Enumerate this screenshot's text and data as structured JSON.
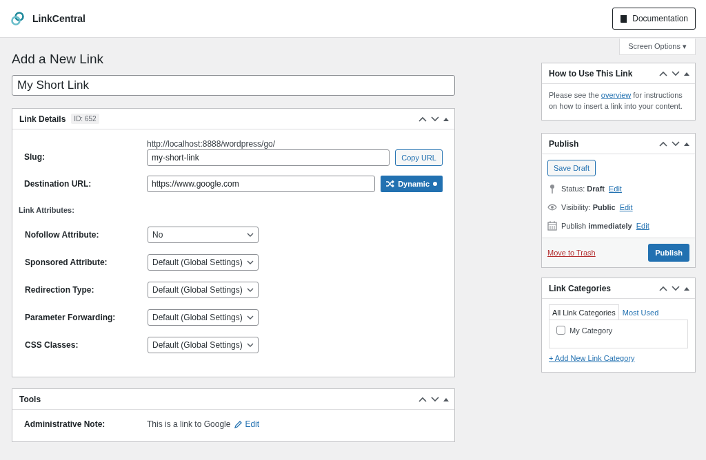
{
  "header": {
    "brand": "LinkCentral",
    "doc_button": "Documentation"
  },
  "screen_options": "Screen Options ▾",
  "page_title": "Add a New Link",
  "title_field": {
    "value": "My Short Link"
  },
  "link_details": {
    "title": "Link Details",
    "id_badge": "ID: 652",
    "fields": [
      {
        "kind": "slug",
        "label": "Slug:",
        "prefix": "http://localhost:8888/wordpress/go/",
        "value": "my-short-link",
        "button": "Copy URL"
      },
      {
        "kind": "url",
        "label": "Destination URL:",
        "value": "https://www.google.com",
        "button": "Dynamic"
      }
    ],
    "attributes_heading": "Link Attributes:",
    "attributes": [
      {
        "label": "Nofollow Attribute:",
        "value": "No"
      },
      {
        "label": "Sponsored Attribute:",
        "value": "Default (Global Settings)"
      },
      {
        "label": "Redirection Type:",
        "value": "Default (Global Settings)"
      },
      {
        "label": "Parameter Forwarding:",
        "value": "Default (Global Settings)"
      },
      {
        "label": "CSS Classes:",
        "value": "Default (Global Settings)"
      }
    ]
  },
  "tools": {
    "title": "Tools",
    "label": "Administrative Note:",
    "note": "This is a link to Google",
    "edit": "Edit"
  },
  "how_to": {
    "title": "How to Use This Link",
    "before": "Please see the",
    "link": "overview",
    "after": "for instructions on how to insert a link into your content."
  },
  "publish": {
    "title": "Publish",
    "save_draft": "Save Draft",
    "rows": [
      {
        "kind": "status",
        "text": "Status: **Draft**",
        "edit": "Edit"
      },
      {
        "kind": "visibility",
        "text": "Visibility: **Public**",
        "edit": "Edit"
      },
      {
        "kind": "schedule",
        "text": "Publish **immediately**",
        "edit": "Edit"
      }
    ],
    "trash": "Move to Trash",
    "publish_button": "Publish"
  },
  "categories": {
    "title": "Link Categories",
    "tabs": [
      {
        "label": "All Link Categories",
        "selected": true
      },
      {
        "label": "Most Used",
        "selected": false
      }
    ],
    "items": [
      {
        "label": "My Category",
        "checked": false
      }
    ],
    "add": "+ Add New Link Category"
  }
}
